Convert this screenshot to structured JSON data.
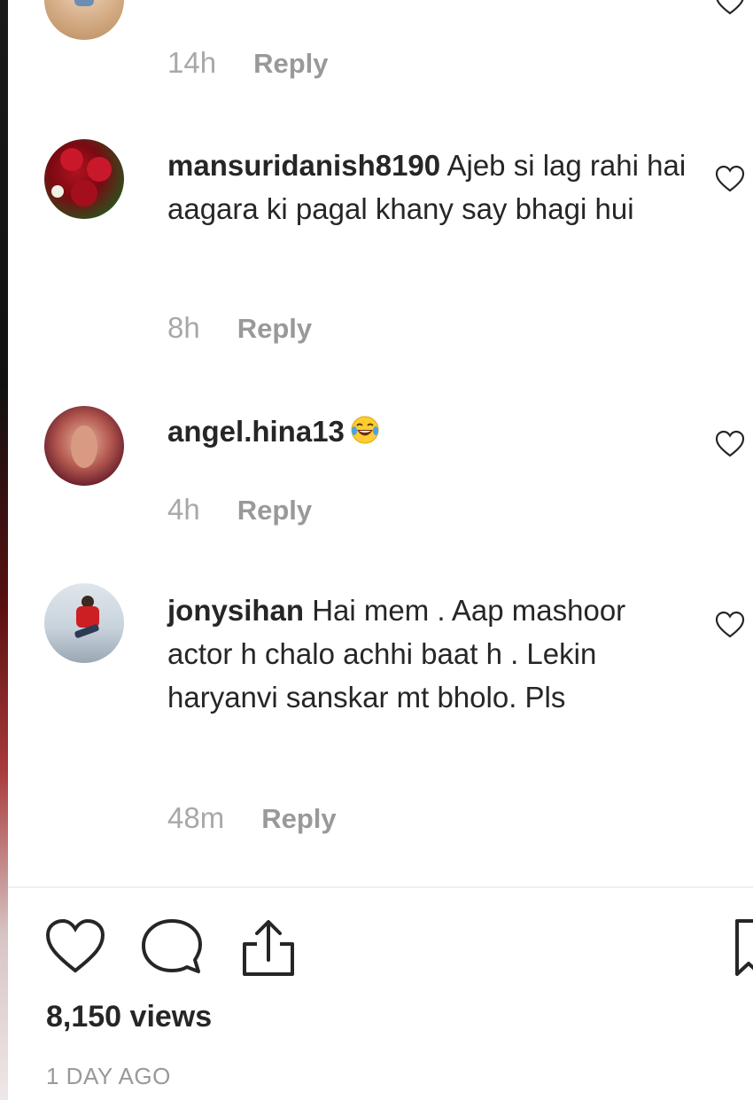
{
  "comments": [
    {
      "time": "14h",
      "reply_label": "Reply"
    },
    {
      "username": "mansuridanish8190",
      "text": " Ajeb si lag rahi hai aagara ki pagal khany say bhagi hui",
      "time": "8h",
      "reply_label": "Reply"
    },
    {
      "username": "angel.hina13",
      "text": "",
      "emoji": "face-with-tears-of-joy",
      "time": "4h",
      "reply_label": "Reply"
    },
    {
      "username": "jonysihan",
      "text": " Hai mem . Aap mashoor actor h chalo achhi baat h . Lekin haryanvi sanskar mt bholo. Pls",
      "time": "48m",
      "reply_label": "Reply"
    }
  ],
  "actions": {
    "like_icon": "heart-icon",
    "comment_icon": "comment-bubble-icon",
    "share_icon": "share-upload-icon",
    "save_icon": "bookmark-icon"
  },
  "post": {
    "views": "8,150 views",
    "date": "1 DAY AGO"
  },
  "colors": {
    "text": "#262626",
    "muted": "#8e8e8e",
    "divider": "#efefef"
  }
}
